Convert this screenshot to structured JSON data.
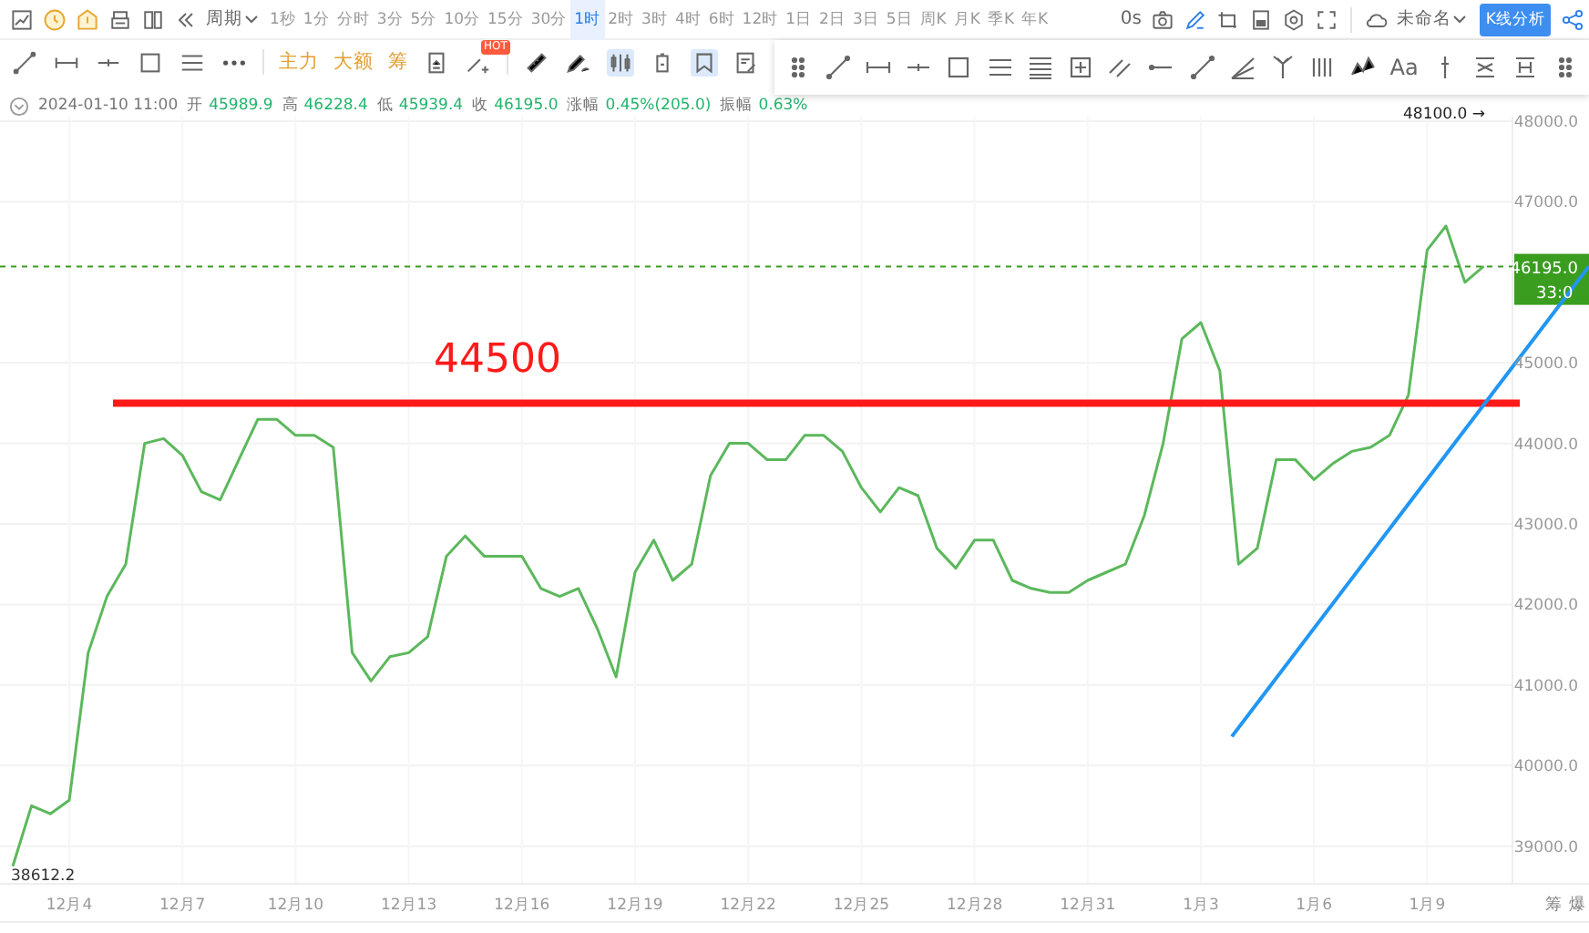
{
  "toolbar": {
    "period": "周期",
    "intervals": [
      {
        "label": "1秒",
        "selected": false
      },
      {
        "label": "1分",
        "selected": false
      },
      {
        "label": "分时",
        "selected": false
      },
      {
        "label": "3分",
        "selected": false
      },
      {
        "label": "5分",
        "selected": false
      },
      {
        "label": "10分",
        "selected": false
      },
      {
        "label": "15分",
        "selected": false
      },
      {
        "label": "30分",
        "selected": false
      },
      {
        "label": "1时",
        "selected": true
      },
      {
        "label": "2时",
        "selected": false
      },
      {
        "label": "3时",
        "selected": false
      },
      {
        "label": "4时",
        "selected": false
      },
      {
        "label": "6时",
        "selected": false
      },
      {
        "label": "12时",
        "selected": false
      },
      {
        "label": "1日",
        "selected": false
      },
      {
        "label": "2日",
        "selected": false
      },
      {
        "label": "3日",
        "selected": false
      },
      {
        "label": "5日",
        "selected": false
      },
      {
        "label": "周K",
        "selected": false
      },
      {
        "label": "月K",
        "selected": false
      },
      {
        "label": "季K",
        "selected": false
      },
      {
        "label": "年K",
        "selected": false
      }
    ],
    "refresh": "0s",
    "layout_name": "未命名",
    "analysis_button": "K线分析"
  },
  "indicator_bar": {
    "indicators": [
      "主力",
      "大额",
      "筹"
    ],
    "hot_badge": "HOT"
  },
  "drawing_panel": {
    "text_tool": "Aa"
  },
  "ohlc": {
    "time": "2024-01-10 11:00",
    "fields": [
      {
        "label": "开",
        "value": "45989.9"
      },
      {
        "label": "高",
        "value": "46228.4"
      },
      {
        "label": "低",
        "value": "45939.4"
      },
      {
        "label": "收",
        "value": "46195.0"
      },
      {
        "label": "涨幅",
        "value": "0.45%(205.0)"
      },
      {
        "label": "振幅",
        "value": "0.63%"
      }
    ]
  },
  "chart": {
    "high_label": "48100.0 →",
    "low_label": "38612.2",
    "overlays": [
      {
        "kind": "trendline",
        "color": "#2196f3"
      },
      {
        "kind": "countdown",
        "text": "33:0"
      }
    ],
    "chart_data": {
      "type": "line",
      "grid": true,
      "ylim": [
        38532,
        48057
      ],
      "ref_lines": [
        {
          "axis": "y",
          "value": 44500,
          "label": "44500",
          "color": "#ff1a1a"
        },
        {
          "axis": "y",
          "value": 46195,
          "label": "46195.0",
          "color": "#3a9d1f"
        }
      ],
      "categories": [
        null,
        null,
        null,
        "12月4",
        null,
        null,
        null,
        null,
        null,
        "12月7",
        null,
        null,
        null,
        null,
        null,
        "12月10",
        null,
        null,
        null,
        null,
        null,
        "12月13",
        null,
        null,
        null,
        null,
        null,
        "12月16",
        null,
        null,
        null,
        null,
        null,
        "12月19",
        null,
        null,
        null,
        null,
        null,
        "12月22",
        null,
        null,
        null,
        null,
        null,
        "12月25",
        null,
        null,
        null,
        null,
        null,
        "12月28",
        null,
        null,
        null,
        null,
        null,
        "12月31",
        null,
        null,
        null,
        null,
        null,
        "1月3",
        null,
        null,
        null,
        null,
        null,
        "1月6",
        null,
        null,
        null,
        null,
        null,
        "1月9",
        null,
        null,
        null
      ],
      "series": [
        {
          "color": "#5cb85c",
          "values": [
            38750,
            39500,
            39400,
            39570,
            41400,
            42100,
            42500,
            44000,
            44060,
            43850,
            43400,
            43300,
            43800,
            44300,
            44300,
            44100,
            44100,
            43950,
            41400,
            41050,
            41350,
            41400,
            41600,
            42600,
            42850,
            42600,
            42600,
            42600,
            42200,
            42100,
            42200,
            41700,
            41100,
            42400,
            42800,
            42300,
            42500,
            43600,
            44000,
            44000,
            43800,
            43800,
            44100,
            44100,
            43900,
            43450,
            43150,
            43450,
            43350,
            42700,
            42450,
            42800,
            42800,
            42300,
            42200,
            42150,
            42150,
            42300,
            42400,
            42500,
            43100,
            44000,
            45300,
            45500,
            44900,
            42500,
            42700,
            43800,
            43800,
            43550,
            43750,
            43900,
            43950,
            44100,
            44600,
            46400,
            46700,
            46000,
            46200
          ]
        }
      ],
      "yticks": [
        {
          "value": 39000,
          "label": "39000.0"
        },
        {
          "value": 40000,
          "label": "40000.0"
        },
        {
          "value": 41000,
          "label": "41000.0"
        },
        {
          "value": 42000,
          "label": "42000.0"
        },
        {
          "value": 43000,
          "label": "43000.0"
        },
        {
          "value": 44000,
          "label": "44000.0"
        },
        {
          "value": 45000,
          "label": "45000.0"
        },
        {
          "value": 47000,
          "label": "47000.0"
        },
        {
          "value": 48000,
          "label": "48000.0"
        }
      ]
    }
  },
  "side_buttons": [
    "筹",
    "爆"
  ]
}
